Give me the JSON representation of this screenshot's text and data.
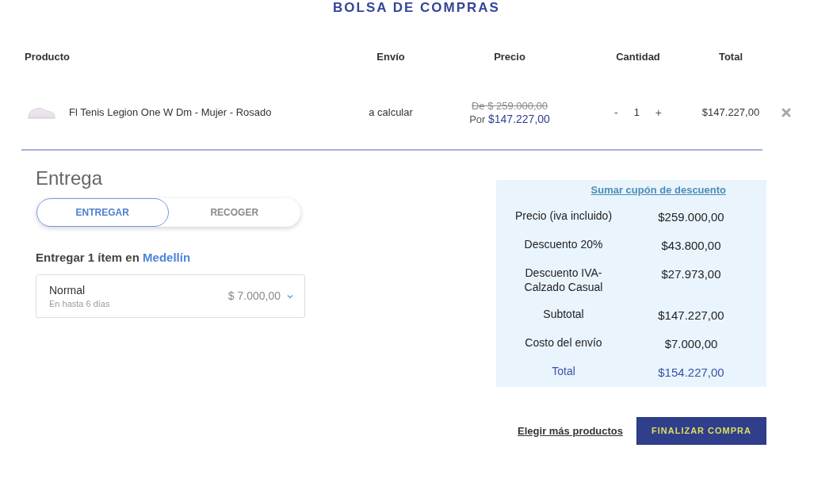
{
  "page_title": "BOLSA DE COMPRAS",
  "cart_table": {
    "columns": [
      "Producto",
      "Envío",
      "Precio",
      "Cantidad",
      "Total"
    ],
    "rows": [
      {
        "product": "Fl Tenis Legion One W Dm - Mujer - Rosado",
        "shipping": "a calcular",
        "old_price": "De $ 259.000,00",
        "price_prefix": "Por",
        "price": "$147.227,00",
        "quantity": {
          "decrease": "-",
          "value": "1",
          "increase": "+"
        },
        "total": "$147.227,00"
      }
    ]
  },
  "delivery": {
    "title": "Entrega",
    "tabs": [
      {
        "label": "ENTREGAR",
        "selected": true
      },
      {
        "label": "RECOGER",
        "selected": false
      }
    ],
    "heading": "Entregar 1 ítem en",
    "city": "Medellín",
    "option": {
      "name": "Normal",
      "eta": "En hasta 6 días",
      "price": "$ 7.000,00"
    }
  },
  "summary": {
    "coupon_link": "Sumar cupón de descuento",
    "rows": [
      {
        "kind": "line",
        "label": "Precio (iva incluido)",
        "value": "$259.000,00"
      },
      {
        "kind": "line",
        "label": "Descuento 20%",
        "value": "$43.800,00"
      },
      {
        "kind": "line",
        "label": "Descuento IVA-Calzado Casual",
        "value": "$27.973,00"
      },
      {
        "kind": "line",
        "label": "Subtotal",
        "value": "$147.227,00"
      },
      {
        "kind": "line",
        "label": "Costo del envío",
        "value": "$7.000,00"
      },
      {
        "kind": "total",
        "label": "Total",
        "value": "$154.227,00"
      }
    ]
  },
  "actions": {
    "link": "Elegir más productos",
    "button": "FINALIZAR COMPRA"
  }
}
